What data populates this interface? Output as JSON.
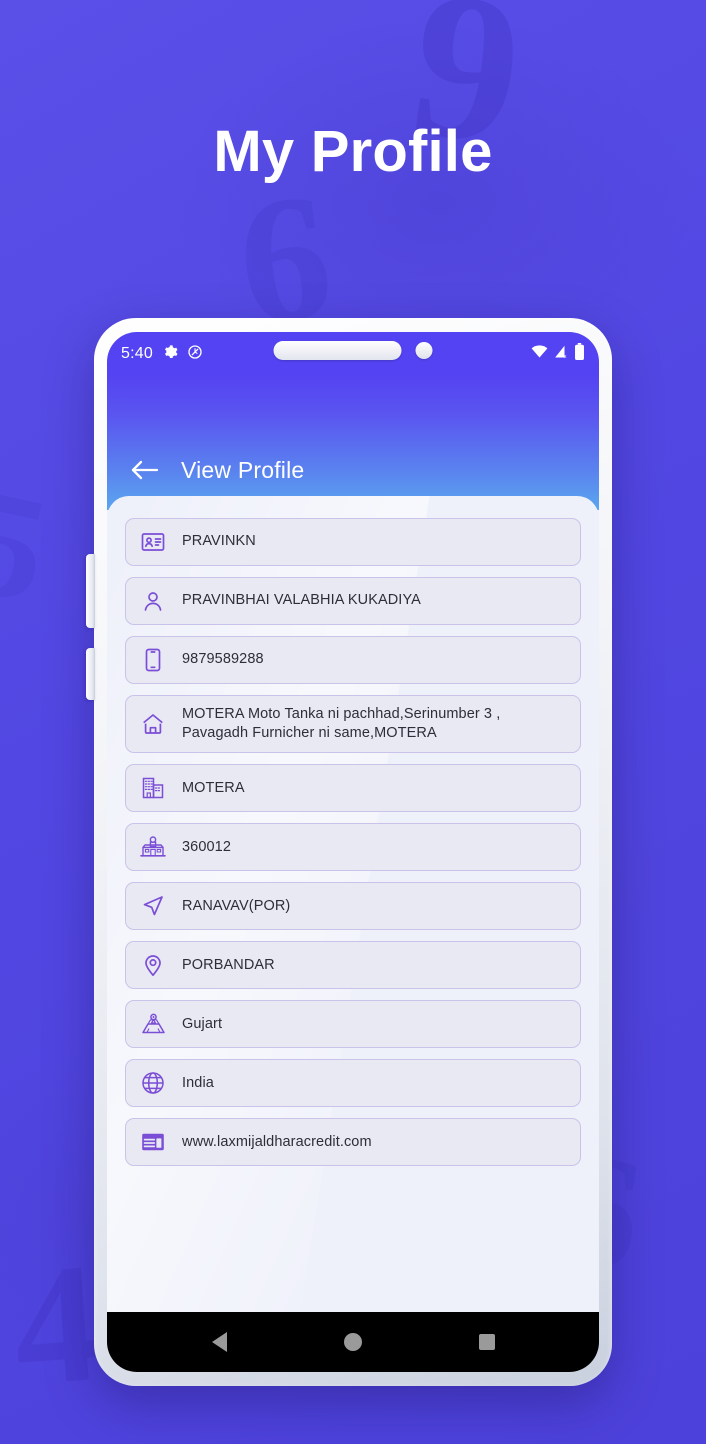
{
  "hero": {
    "title": "My Profile"
  },
  "statusbar": {
    "time": "5:40",
    "icons": [
      "gear-icon",
      "location-off-icon",
      "wifi-icon",
      "signal-no-sim-icon",
      "battery-full-icon"
    ]
  },
  "appbar": {
    "back_label": "back-arrow",
    "title": "View Profile"
  },
  "profile": {
    "fields": [
      {
        "icon": "id-card-icon",
        "name": "username",
        "value": "PRAVINKN"
      },
      {
        "icon": "person-icon",
        "name": "full-name",
        "value": "PRAVINBHAI VALABHIA KUKADIYA"
      },
      {
        "icon": "phone-icon",
        "name": "mobile",
        "value": "9879589288"
      },
      {
        "icon": "home-icon",
        "name": "address",
        "value": "MOTERA Moto Tanka ni pachhad,Serinumber 3 , Pavagadh Furnicher ni same,MOTERA"
      },
      {
        "icon": "building-icon",
        "name": "city",
        "value": "MOTERA"
      },
      {
        "icon": "post-office-icon",
        "name": "pincode",
        "value": "360012"
      },
      {
        "icon": "navigation-icon",
        "name": "taluka",
        "value": "RANAVAV(POR)"
      },
      {
        "icon": "map-pin-icon",
        "name": "district",
        "value": "PORBANDAR"
      },
      {
        "icon": "map-icon",
        "name": "state",
        "value": "Gujart"
      },
      {
        "icon": "globe-icon",
        "name": "country",
        "value": "India"
      },
      {
        "icon": "website-icon",
        "name": "website",
        "value": "www.laxmijaldharacredit.com"
      }
    ]
  },
  "navbar": {
    "back": "nav-back",
    "home": "nav-home",
    "recents": "nav-recents"
  },
  "colors": {
    "background": "#5046e0",
    "appbar_top": "#5443f2",
    "appbar_bottom": "#5ba6ef",
    "sheet": "#eef0fa",
    "field_bg": "#e9e9f4",
    "field_border": "#c9c3ea",
    "icon": "#7b4ed6",
    "text": "#2e2e38"
  },
  "background_marks": [
    "9",
    "6",
    "4",
    "6",
    "5"
  ]
}
